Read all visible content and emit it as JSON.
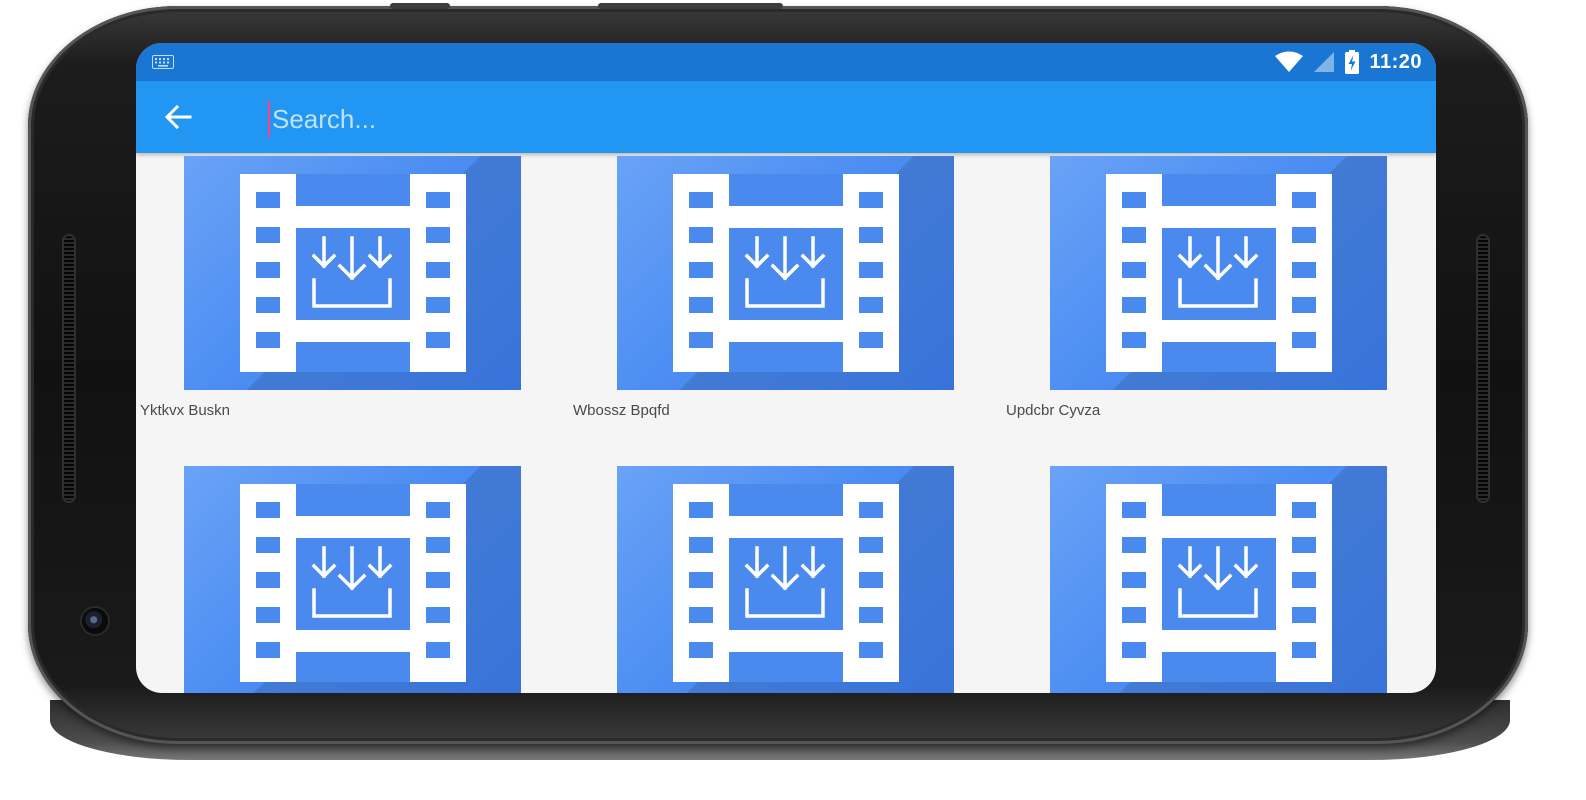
{
  "statusbar": {
    "time": "11:20",
    "icons": [
      "keyboard-icon",
      "wifi-icon",
      "signal-icon",
      "battery-charging-icon"
    ]
  },
  "appbar": {
    "back_icon": "arrow-back-icon",
    "search_placeholder": "Search...",
    "search_value": ""
  },
  "grid": {
    "thumbnail_icon": "video-download-icon",
    "items": [
      {
        "title": "Yktkvx Buskn"
      },
      {
        "title": "Wbossz Bpqfd"
      },
      {
        "title": "Updcbr Cyvza"
      },
      {
        "title": ""
      },
      {
        "title": ""
      },
      {
        "title": ""
      }
    ]
  },
  "colors": {
    "statusbar": "#1976d2",
    "appbar": "#2196f3",
    "thumbnail": "#4d8ef3",
    "cursor": "#ff4081",
    "background": "#f5f5f5"
  }
}
